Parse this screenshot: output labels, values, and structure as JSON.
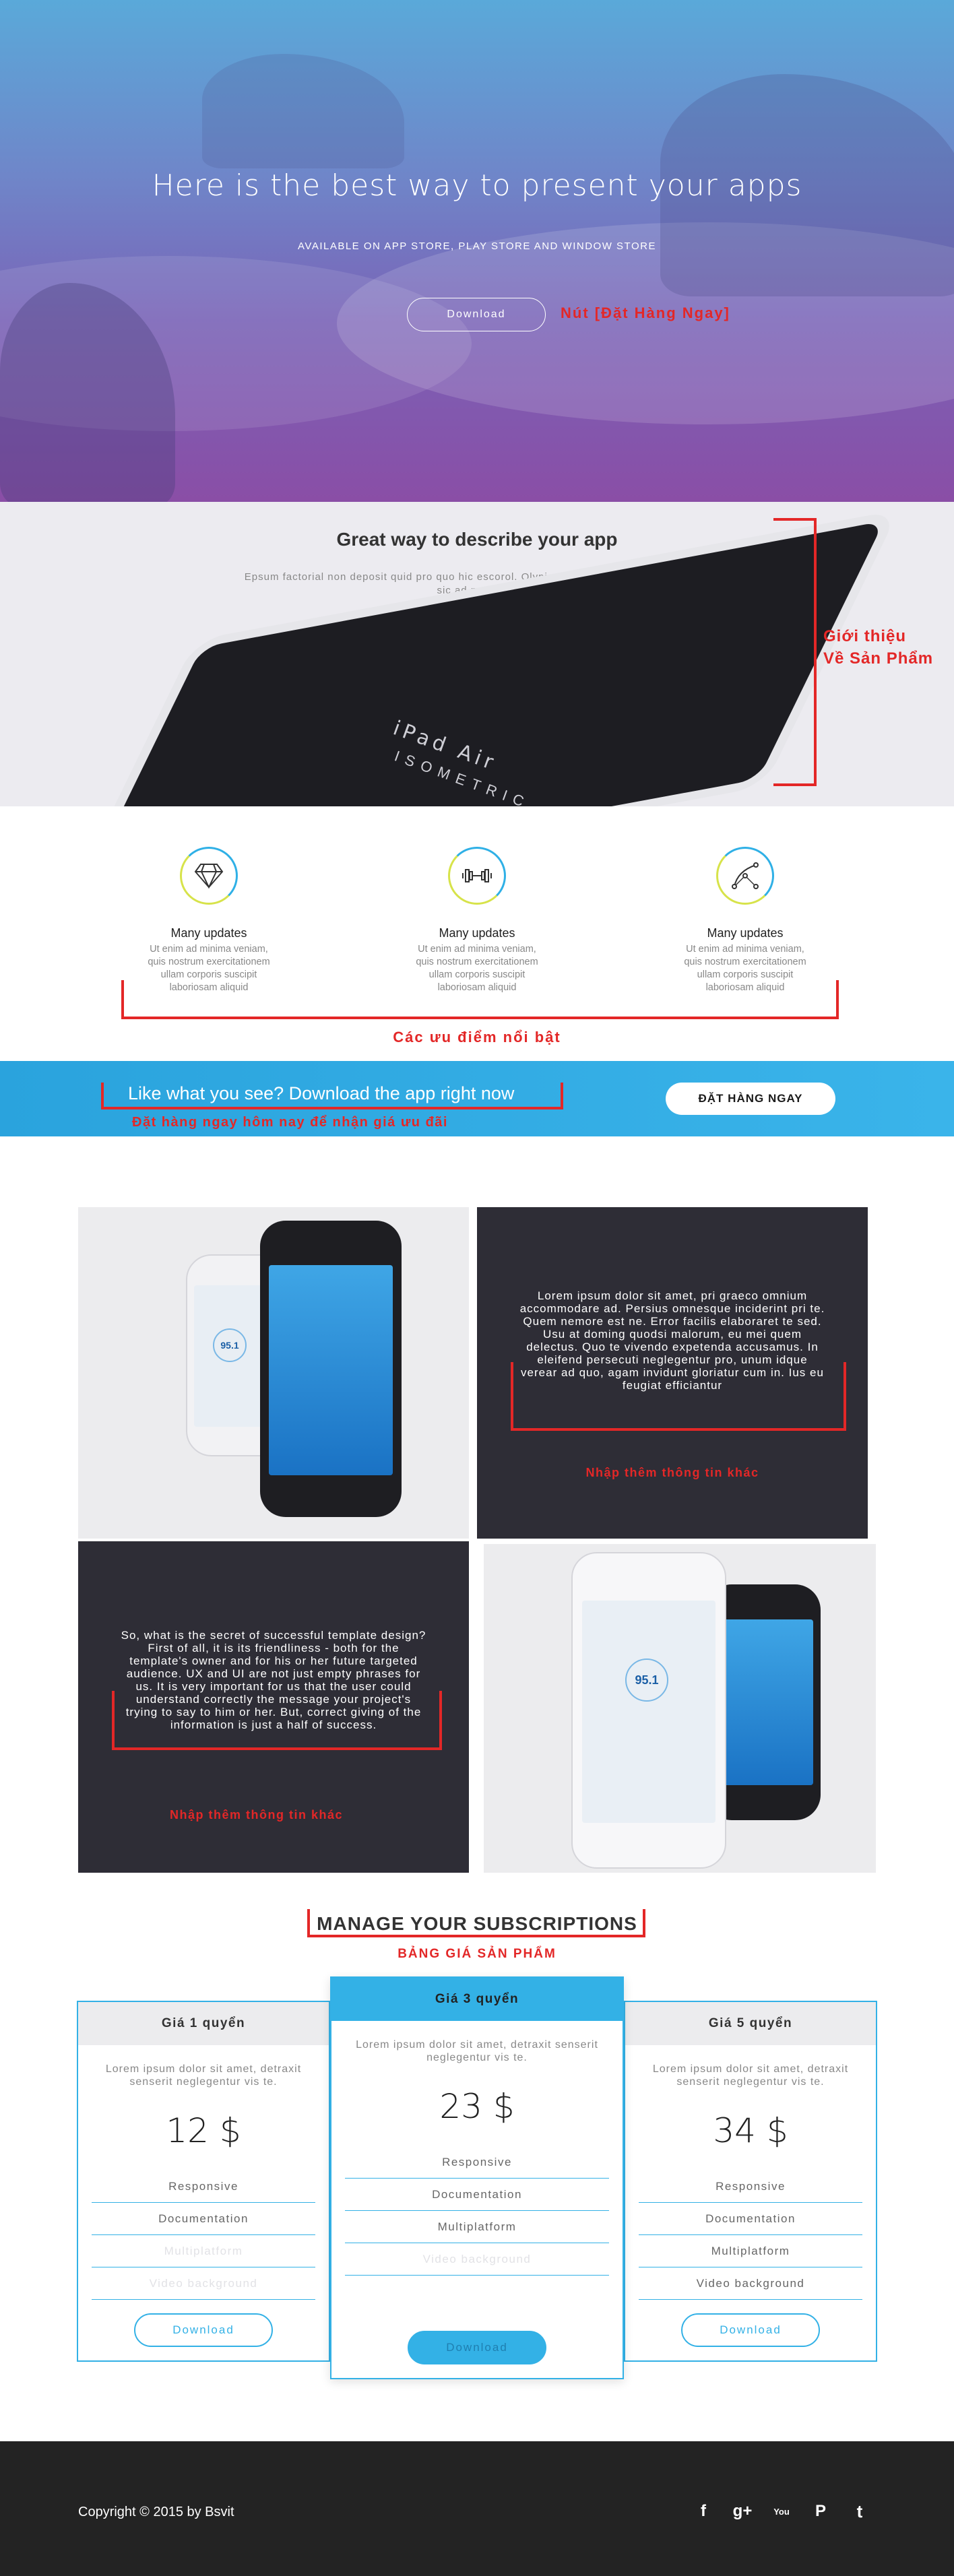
{
  "hero": {
    "title": "Here is the best way to present your apps",
    "subtitle": "AVAILABLE ON APP STORE, PLAY STORE AND WINDOW STORE",
    "button": "Download",
    "annotation": "Nút [Đặt Hàng Ngay]"
  },
  "intro": {
    "title": "Great way to describe your app",
    "text": "Epsum factorial non deposit quid pro quo hic escorol. Olypian quarrels et gorilla congolium sic ad nauseum",
    "device_text": "iPad Air",
    "device_text2": "ISOMETRIC",
    "annotation_line1": "Giới thiệu",
    "annotation_line2": "Về Sản Phẩm"
  },
  "features": {
    "items": [
      {
        "title": "Many updates",
        "text": "Ut enim ad minima veniam, quis nostrum exercitationem ullam corporis suscipit laboriosam aliquid",
        "icon": "diamond-icon"
      },
      {
        "title": "Many updates",
        "text": "Ut enim ad minima veniam, quis nostrum exercitationem ullam corporis suscipit laboriosam aliquid",
        "icon": "dumbbell-icon"
      },
      {
        "title": "Many updates",
        "text": "Ut enim ad minima veniam, quis nostrum exercitationem ullam corporis suscipit laboriosam aliquid",
        "icon": "bezier-curve-icon"
      }
    ],
    "annotation": "Các ưu điểm nổi bật"
  },
  "cta": {
    "title": "Like what you see? Download the app right now",
    "annotation": "Đặt hàng ngay hôm nay để nhận giá ưu đãi",
    "button": "ĐẶT HÀNG NGAY"
  },
  "gallery": {
    "panel1_text": "Lorem ipsum dolor sit amet, pri graeco omnium accommodare ad. Persius omnesque inciderint pri te. Quem nemore est ne. Error facilis elaboraret te sed. Usu at doming quodsi malorum, eu mei quem delectus. Quo te vivendo expetenda accusamus. In eleifend persecuti neglegentur pro, unum idque verear ad quo, agam invidunt gloriatur cum in. Ius eu feugiat efficiantur",
    "panel1_annotation": "Nhập thêm thông tin khác",
    "panel2_text": "So, what is the secret of successful template design? First of all, it is its friendliness - both for the template's owner and for his or her future targeted audience. UX and UI are not just empty phrases for us. It is very important for us that the user could understand correctly the message your project's trying to say to him or her. But, correct giving of the information is just a half of success.",
    "panel2_annotation": "Nhập thêm thông tin khác",
    "phone_value": "95.1"
  },
  "pricing": {
    "title": "MANAGE YOUR SUBSCRIPTIONS",
    "annotation": "BẢNG GIÁ SẢN PHẨM",
    "plans": [
      {
        "name": "Giá 1 quyển",
        "desc": "Lorem ipsum dolor sit amet, detraxit senserit neglegentur vis te.",
        "price": "12 $",
        "features": [
          "Responsive",
          "Documentation",
          "Multiplatform",
          "Video background"
        ],
        "button": "Download"
      },
      {
        "name": "Giá 3 quyển",
        "desc": "Lorem ipsum dolor sit amet, detraxit senserit neglegentur vis te.",
        "price": "23 $",
        "features": [
          "Responsive",
          "Documentation",
          "Multiplatform",
          "Video background"
        ],
        "button": "Download"
      },
      {
        "name": "Giá 5 quyển",
        "desc": "Lorem ipsum dolor sit amet, detraxit senserit neglegentur vis te.",
        "price": "34 $",
        "features": [
          "Responsive",
          "Documentation",
          "Multiplatform",
          "Video background"
        ],
        "button": "Download"
      }
    ]
  },
  "footer": {
    "copyright": "Copyright © 2015  by Bsvit",
    "social": [
      {
        "icon": "facebook-icon",
        "glyph": "f"
      },
      {
        "icon": "google-plus-icon",
        "glyph": "g+"
      },
      {
        "icon": "youtube-icon",
        "glyph": "You"
      },
      {
        "icon": "pinterest-icon",
        "glyph": "P"
      },
      {
        "icon": "twitter-icon",
        "glyph": "t"
      }
    ]
  },
  "colors": {
    "accent": "#33b1e6",
    "annotation": "#e32727",
    "dark_panel": "#2e2d36",
    "footer": "#232323"
  }
}
